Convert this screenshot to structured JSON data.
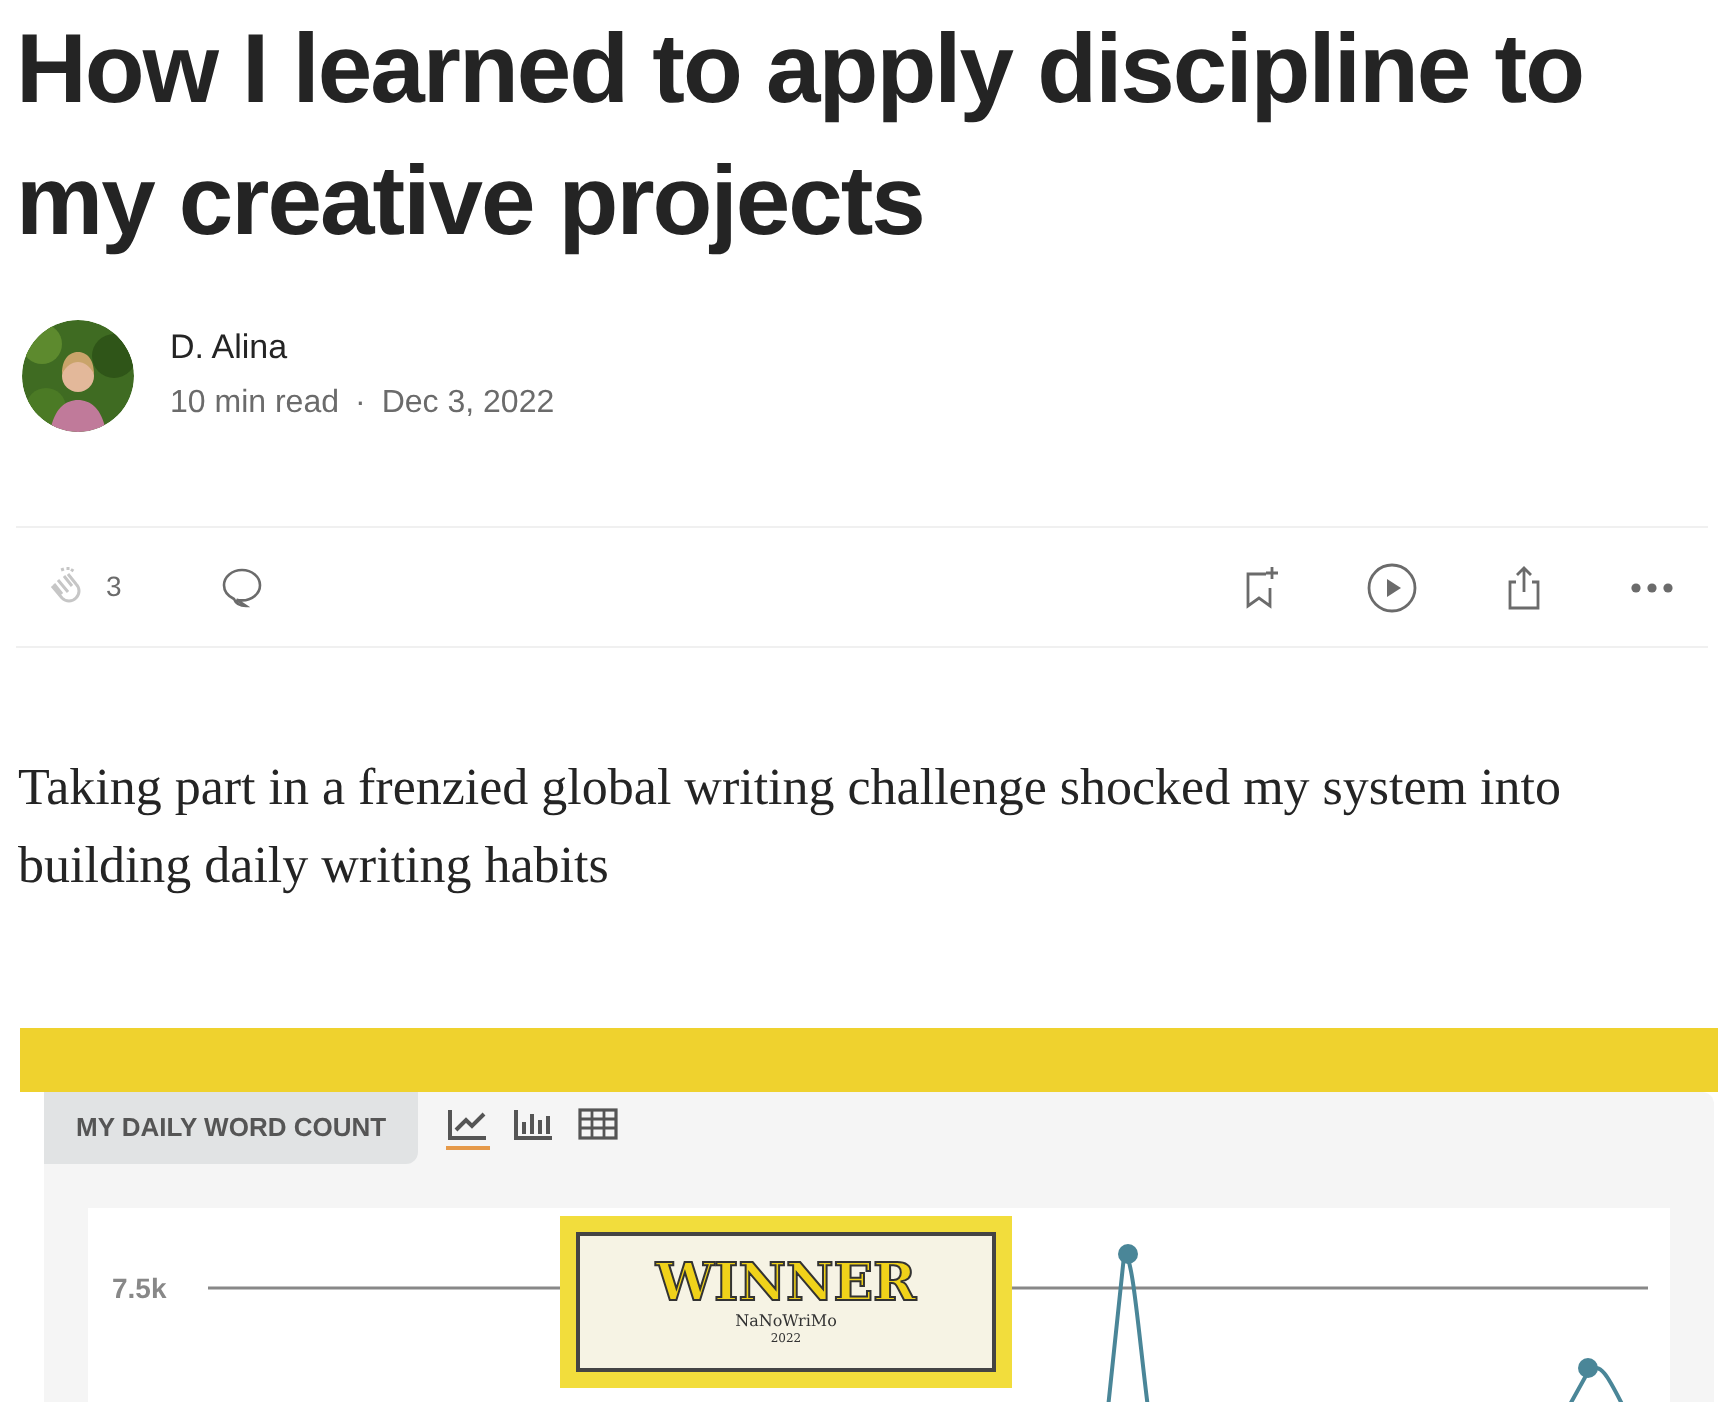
{
  "article": {
    "title": "How I learned to apply discipline to my creative projects",
    "author": {
      "name": "D. Alina"
    },
    "read_time": "10 min read",
    "separator": "·",
    "date": "Dec 3, 2022"
  },
  "actions": {
    "claps": "3"
  },
  "subtitle": "Taking part in a frenzied global writing challenge shocked my system into building daily writing habits",
  "figure": {
    "panel_title": "MY DAILY WORD COUNT",
    "views": [
      {
        "kind": "line",
        "selected": true
      },
      {
        "kind": "bar",
        "selected": false
      },
      {
        "kind": "table",
        "selected": false
      }
    ],
    "y_tick": "7.5k",
    "badge": {
      "title": "WINNER",
      "org": "NaNoWriMo",
      "year": "2022"
    }
  }
}
